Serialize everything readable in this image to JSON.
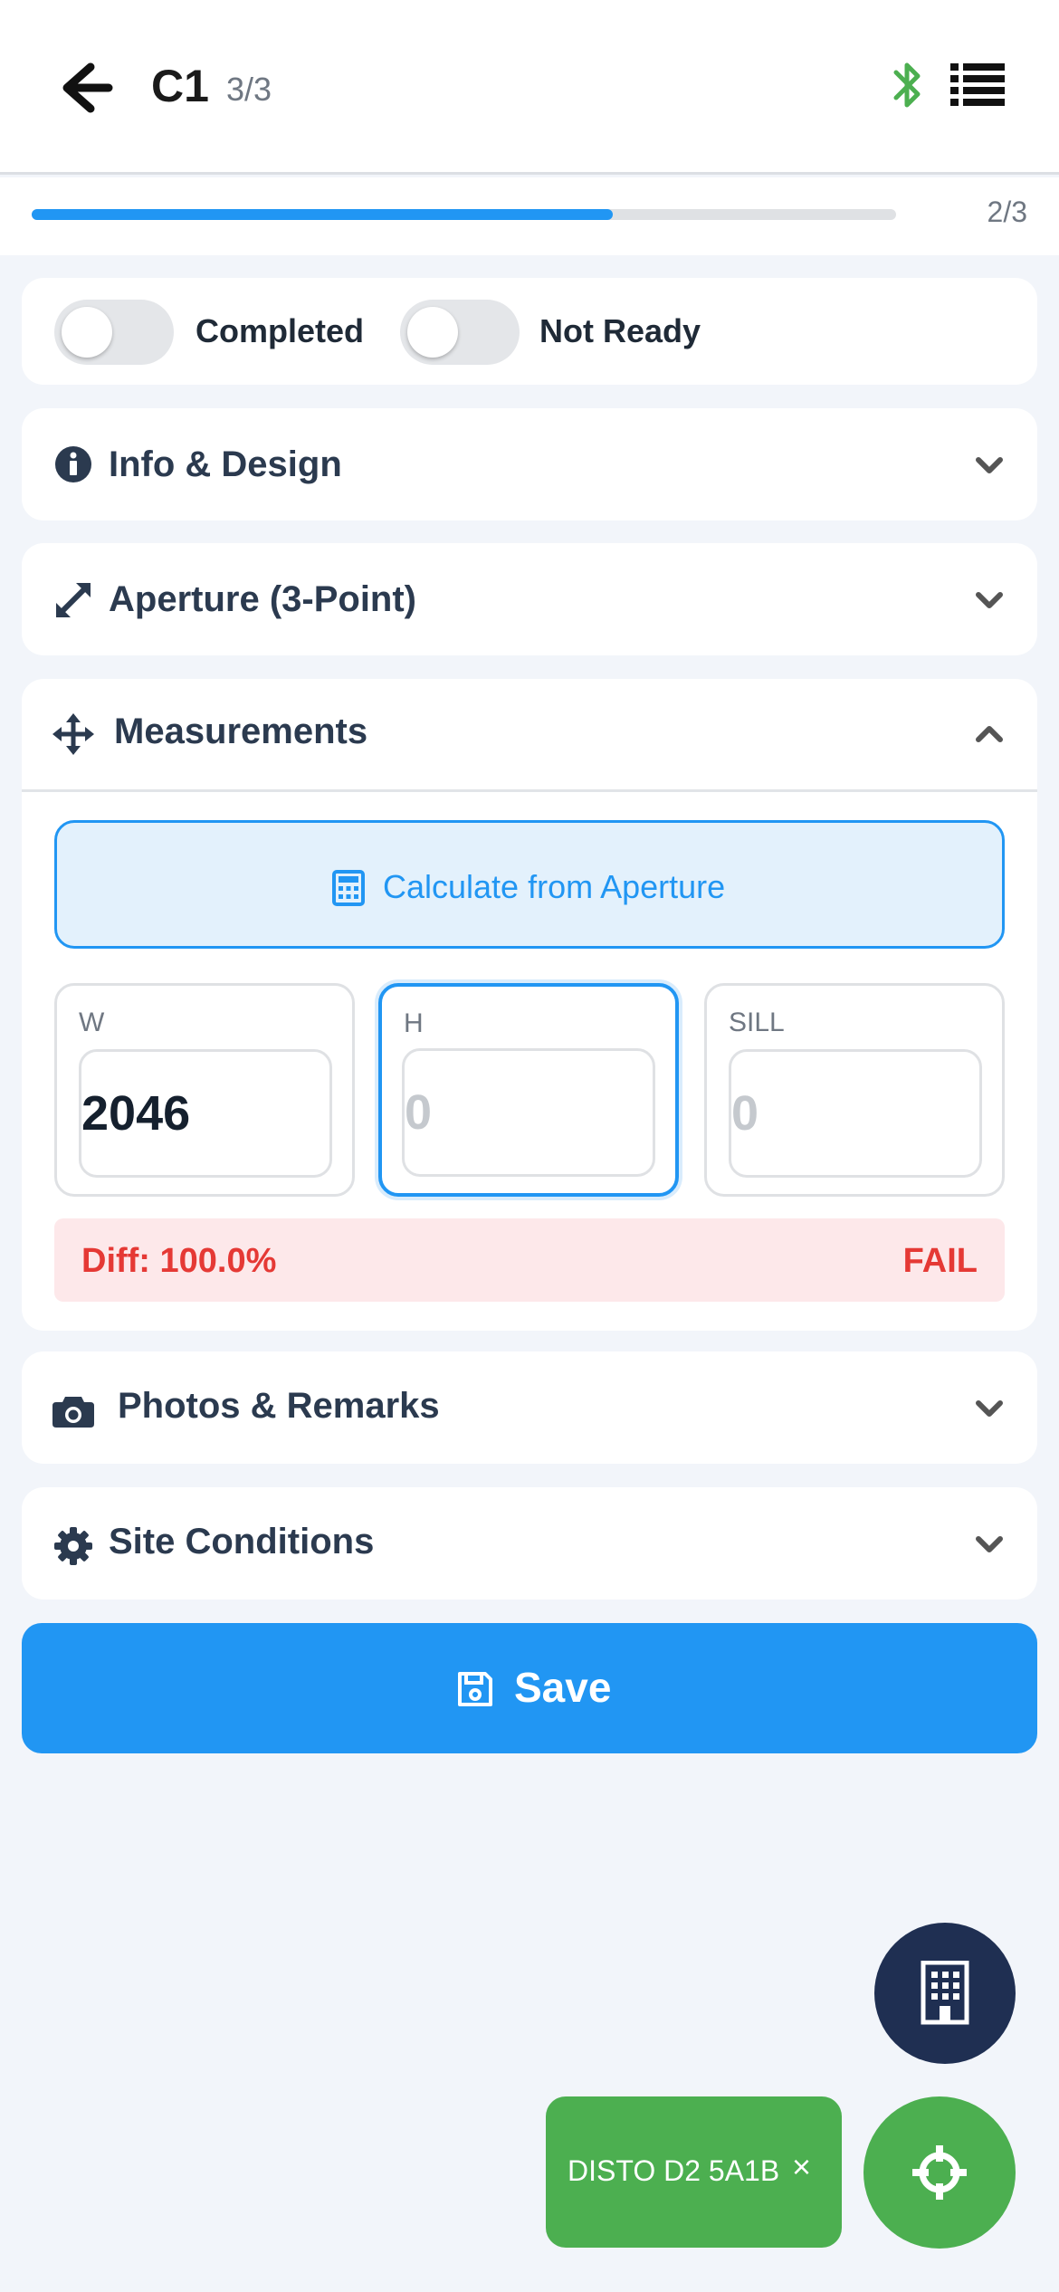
{
  "header": {
    "title": "C1",
    "count": "3/3"
  },
  "progress": {
    "label": "2/3",
    "fill_fraction": 0.672
  },
  "toggles": [
    {
      "label": "Completed",
      "on": false
    },
    {
      "label": "Not Ready",
      "on": false
    }
  ],
  "sections": {
    "info": {
      "title": "Info & Design",
      "expanded": false
    },
    "aperture": {
      "title": "Aperture (3-Point)",
      "expanded": false
    },
    "measurements": {
      "title": "Measurements",
      "expanded": true
    },
    "photos": {
      "title": "Photos & Remarks",
      "expanded": false
    },
    "site": {
      "title": "Site Conditions",
      "expanded": false
    }
  },
  "calc_button": {
    "label": "Calculate from Aperture"
  },
  "fields": {
    "w": {
      "label": "W",
      "value": "2046",
      "placeholder": "0"
    },
    "h": {
      "label": "H",
      "value": "",
      "placeholder": "0"
    },
    "sill": {
      "label": "SILL",
      "value": "",
      "placeholder": "0"
    }
  },
  "diff": {
    "text": "Diff: 100.0%",
    "status": "FAIL"
  },
  "save": {
    "label": "Save"
  },
  "device_chip": {
    "label": "DISTO D2 5A1B",
    "close": "×"
  },
  "colors": {
    "accent": "#2196f3",
    "success": "#4caf50",
    "danger": "#e53935",
    "navy": "#1f2f52"
  },
  "icons": [
    "back-arrow-icon",
    "bluetooth-icon",
    "list-icon",
    "info-icon",
    "expand-icon",
    "move-icon",
    "calculator-icon",
    "camera-icon",
    "gear-icon",
    "chevron-down-icon",
    "chevron-up-icon",
    "save-icon",
    "building-icon",
    "crosshair-icon",
    "close-icon"
  ]
}
